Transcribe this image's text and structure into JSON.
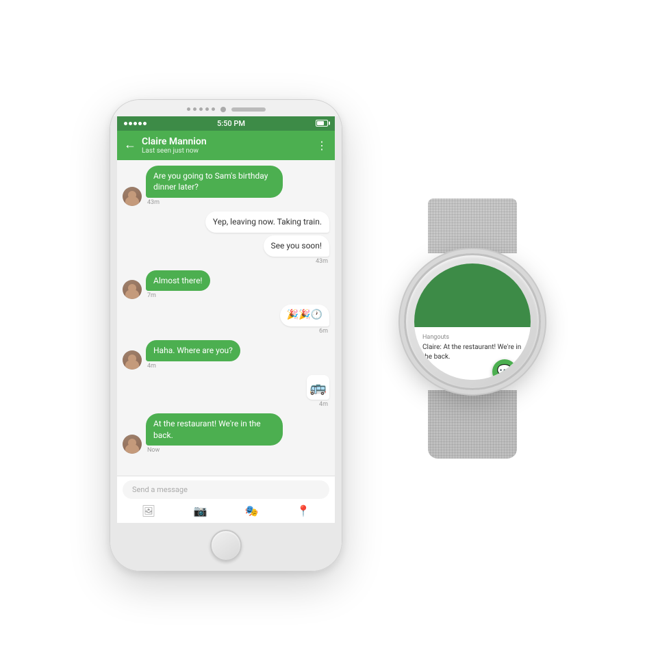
{
  "phone": {
    "status_bar": {
      "signals": "•••••",
      "time": "5:50 PM",
      "battery": ""
    },
    "header": {
      "back_label": "←",
      "contact_name": "Claire Mannion",
      "contact_status": "Last seen just now",
      "menu_label": "⋮"
    },
    "messages": [
      {
        "id": "msg1",
        "type": "received",
        "text": "Are you going to Sam's birthday dinner later?",
        "time": "43m",
        "has_avatar": true
      },
      {
        "id": "msg2",
        "type": "sent",
        "text": "Yep, leaving now. Taking train.",
        "time": ""
      },
      {
        "id": "msg3",
        "type": "sent",
        "text": "See you soon!",
        "time": "43m"
      },
      {
        "id": "msg4",
        "type": "received",
        "text": "Almost there!",
        "time": "7m",
        "has_avatar": true
      },
      {
        "id": "msg5",
        "type": "sent",
        "text": "🎉🎉🕐",
        "time": "6m",
        "is_emoji": true
      },
      {
        "id": "msg6",
        "type": "received",
        "text": "Haha. Where are you?",
        "time": "4m",
        "has_avatar": true
      },
      {
        "id": "msg7",
        "type": "sent",
        "text": "🚌",
        "time": "4m",
        "is_sticker": true
      },
      {
        "id": "msg8",
        "type": "received",
        "text": "At the restaurant! We're in the back.",
        "time": "Now",
        "has_avatar": true
      }
    ],
    "input": {
      "placeholder": "Send a message"
    },
    "input_icons": [
      "🖼",
      "📷",
      "🎭",
      "📍"
    ]
  },
  "watch": {
    "app_name": "Hangouts",
    "notification_text": "Claire: At the restaurant! We're in the back.",
    "icon_symbol": "💬"
  }
}
